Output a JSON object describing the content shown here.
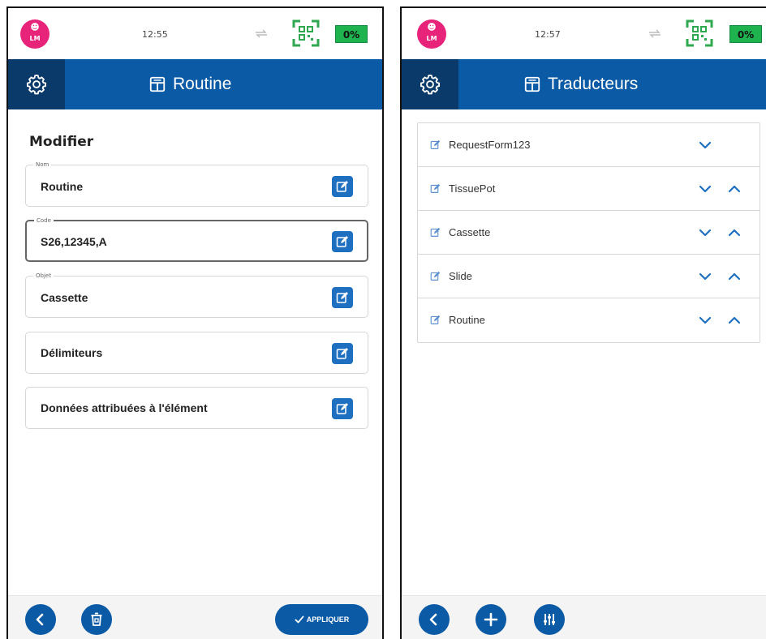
{
  "colors": {
    "primary": "#0b5aa6",
    "primary_dark": "#0a3a6a",
    "avatar": "#e8247a",
    "battery": "#1fb34f",
    "qr": "#2fa84f"
  },
  "left_screen": {
    "status": {
      "avatar_initials": "LM",
      "time": "12:55",
      "battery_text": "0%"
    },
    "header": {
      "title": "Routine",
      "icon": "list-layout-icon"
    },
    "section_title": "Modifier",
    "fields": [
      {
        "label": "Nom",
        "value": "Routine"
      },
      {
        "label": "Code",
        "value": "S26,12345,A"
      },
      {
        "label": "Objet",
        "value": "Cassette"
      },
      {
        "label": "",
        "value": "Délimiteurs"
      },
      {
        "label": "",
        "value": "Données attribuées à l'élément"
      }
    ],
    "bottom": {
      "apply_label": "APPLIQUER"
    }
  },
  "right_screen": {
    "status": {
      "avatar_initials": "LM",
      "time": "12:57",
      "battery_text": "0%"
    },
    "header": {
      "title": "Traducteurs",
      "icon": "list-layout-icon"
    },
    "items": [
      {
        "label": "RequestForm123"
      },
      {
        "label": "TissuePot"
      },
      {
        "label": "Cassette"
      },
      {
        "label": "Slide"
      },
      {
        "label": "Routine"
      }
    ]
  }
}
